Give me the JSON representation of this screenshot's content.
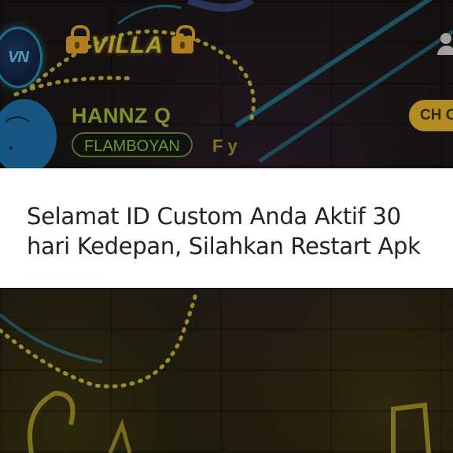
{
  "header": {
    "logo_text": "VN",
    "title": "VILLA"
  },
  "profile": {
    "name": "HANNZ Q",
    "badge": "FLAMBOYAN",
    "tag": "F y"
  },
  "actions": {
    "ch_button_label": "CH C"
  },
  "toast": {
    "message": "Selamat ID Custom Anda Aktif 30 hari Kedepan, Silahkan Restart Apk"
  },
  "colors": {
    "accent_gold": "#e6b52d",
    "name_green": "#9dbb35",
    "neon_blue": "#2a8ea8"
  }
}
